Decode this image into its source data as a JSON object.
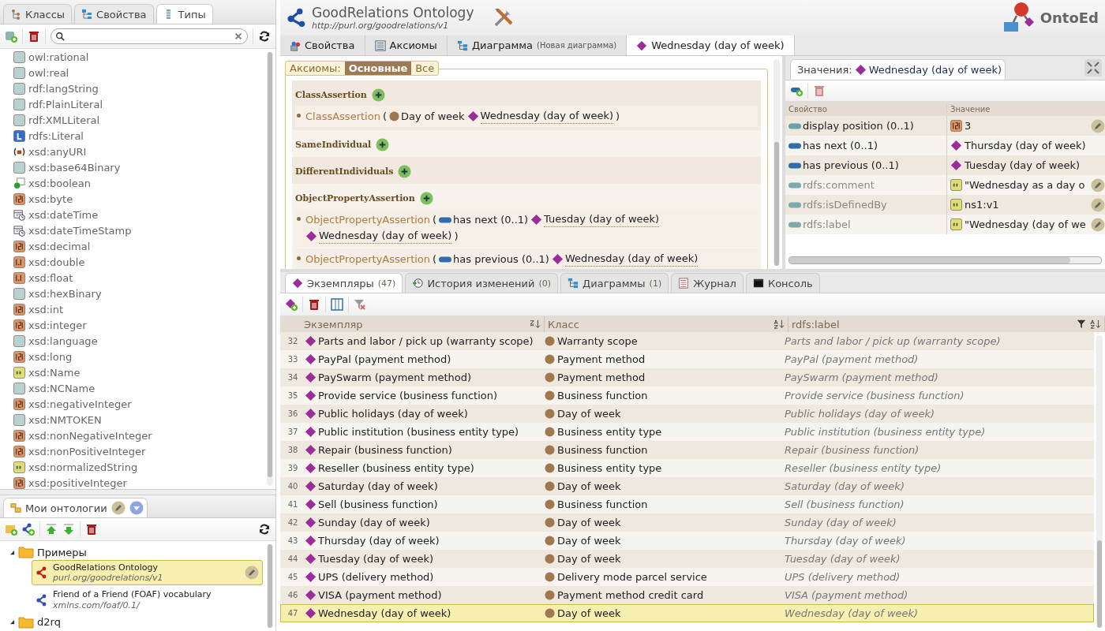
{
  "left_tabs": [
    {
      "label": "Классы",
      "kind": "classes",
      "selected": false
    },
    {
      "label": "Свойства",
      "kind": "properties",
      "selected": false
    },
    {
      "label": "Типы",
      "kind": "types",
      "selected": true
    }
  ],
  "types": [
    {
      "name": "owl:rational",
      "kind": "plain"
    },
    {
      "name": "owl:real",
      "kind": "plain"
    },
    {
      "name": "rdf:langString",
      "kind": "plain"
    },
    {
      "name": "rdf:PlainLiteral",
      "kind": "plain"
    },
    {
      "name": "rdf:XMLLiteral",
      "kind": "plain"
    },
    {
      "name": "rdfs:Literal",
      "kind": "literal"
    },
    {
      "name": "xsd:anyURI",
      "kind": "uri"
    },
    {
      "name": "xsd:base64Binary",
      "kind": "plain"
    },
    {
      "name": "xsd:boolean",
      "kind": "boolean"
    },
    {
      "name": "xsd:byte",
      "kind": "number"
    },
    {
      "name": "xsd:dateTime",
      "kind": "datetime"
    },
    {
      "name": "xsd:dateTimeStamp",
      "kind": "datetime"
    },
    {
      "name": "xsd:decimal",
      "kind": "number"
    },
    {
      "name": "xsd:double",
      "kind": "decimal"
    },
    {
      "name": "xsd:float",
      "kind": "decimal"
    },
    {
      "name": "xsd:hexBinary",
      "kind": "plain"
    },
    {
      "name": "xsd:int",
      "kind": "number"
    },
    {
      "name": "xsd:integer",
      "kind": "number"
    },
    {
      "name": "xsd:language",
      "kind": "plain"
    },
    {
      "name": "xsd:long",
      "kind": "number"
    },
    {
      "name": "xsd:Name",
      "kind": "string"
    },
    {
      "name": "xsd:NCName",
      "kind": "plain"
    },
    {
      "name": "xsd:negativeInteger",
      "kind": "number"
    },
    {
      "name": "xsd:NMTOKEN",
      "kind": "plain"
    },
    {
      "name": "xsd:nonNegativeInteger",
      "kind": "number"
    },
    {
      "name": "xsd:nonPositiveInteger",
      "kind": "number"
    },
    {
      "name": "xsd:normalizedString",
      "kind": "string"
    },
    {
      "name": "xsd:positiveInteger",
      "kind": "number"
    }
  ],
  "ontologies_panel": {
    "title": "Мои онтологии",
    "tree": [
      {
        "label": "Примеры",
        "expanded": true,
        "children": [
          {
            "label": "GoodRelations Ontology",
            "uri": "purl.org/goodrelations/v1",
            "selected": true
          },
          {
            "label": "Friend of a Friend (FOAF) vocabulary",
            "uri": "xmlns.com/foaf/0.1/",
            "selected": false
          }
        ]
      },
      {
        "label": "d2rq",
        "expanded": true
      }
    ]
  },
  "header": {
    "title": "GoodRelations Ontology",
    "uri": "http://purl.org/goodrelations/v1",
    "logo": "OntoEd"
  },
  "main_tabs": [
    {
      "label": "Свойства",
      "kind": "properties",
      "selected": false
    },
    {
      "label": "Аксиомы",
      "kind": "axioms",
      "selected": false
    },
    {
      "label": "Диаграмма",
      "note": "(Новая диаграмма)",
      "kind": "diagram",
      "selected": false
    },
    {
      "label": "Wednesday (day of week)",
      "kind": "individual",
      "selected": true
    }
  ],
  "axiom_filter": {
    "label": "Аксиомы:",
    "options": [
      {
        "label": "Основные",
        "selected": true
      },
      {
        "label": "Все",
        "selected": false
      }
    ]
  },
  "axiom_sections": [
    {
      "title": "ClassAssertion",
      "items": [
        [
          {
            "kind": "fn",
            "text": "ClassAssertion"
          },
          {
            "kind": "punct",
            "text": "("
          },
          {
            "kind": "class",
            "text": "Day of week"
          },
          {
            "kind": "individual",
            "text": "Wednesday (day of week)"
          },
          {
            "kind": "punct",
            "text": ")"
          }
        ]
      ]
    },
    {
      "title": "SameIndividual"
    },
    {
      "title": "DifferentIndividuals"
    },
    {
      "title": "ObjectPropertyAssertion",
      "items": [
        [
          {
            "kind": "fn",
            "text": "ObjectPropertyAssertion"
          },
          {
            "kind": "punct",
            "text": "("
          },
          {
            "kind": "property",
            "text": "has next (0..1)"
          },
          {
            "kind": "individual",
            "text": "Tuesday (day of week)"
          },
          {
            "kind": "individual",
            "text": "Wednesday (day of week)"
          },
          {
            "kind": "punct",
            "text": ")"
          }
        ],
        [
          {
            "kind": "fn",
            "text": "ObjectPropertyAssertion"
          },
          {
            "kind": "punct",
            "text": "("
          },
          {
            "kind": "property",
            "text": "has previous (0..1)"
          },
          {
            "kind": "individual",
            "text": "Wednesday (day of week)"
          }
        ]
      ]
    }
  ],
  "values_panel": {
    "title": "Значения:",
    "subject": "Wednesday (day of week)",
    "columns": [
      "Свойство",
      "Значение"
    ],
    "rows": [
      {
        "property": {
          "kind": "data",
          "text": "display position (0..1)"
        },
        "value": {
          "kind": "number",
          "text": "3"
        },
        "editable": true
      },
      {
        "property": {
          "kind": "object",
          "text": "has next (0..1)"
        },
        "value": {
          "kind": "individual",
          "text": "Thursday (day of week)"
        },
        "editable": false
      },
      {
        "property": {
          "kind": "object",
          "text": "has previous (0..1)"
        },
        "value": {
          "kind": "individual",
          "text": "Tuesday (day of week)"
        },
        "editable": false
      },
      {
        "property": {
          "kind": "annotation",
          "text": "rdfs:comment"
        },
        "value": {
          "kind": "string",
          "text": "\"Wednesday as a day o"
        },
        "editable": true
      },
      {
        "property": {
          "kind": "annotation",
          "text": "rdfs:isDefinedBy"
        },
        "value": {
          "kind": "string",
          "text": "ns1:v1"
        },
        "editable": true
      },
      {
        "property": {
          "kind": "annotation",
          "text": "rdfs:label"
        },
        "value": {
          "kind": "string",
          "text": "\"Wednesday (day of we"
        },
        "editable": true
      }
    ]
  },
  "bottom_tabs": [
    {
      "label": "Экземпляры",
      "count": "(47)",
      "kind": "individuals",
      "selected": true
    },
    {
      "label": "История изменений",
      "count": "(0)",
      "kind": "history",
      "selected": false
    },
    {
      "label": "Диаграммы",
      "count": "(1)",
      "kind": "diagram",
      "selected": false
    },
    {
      "label": "Журнал",
      "kind": "log",
      "selected": false
    },
    {
      "label": "Консоль",
      "kind": "console",
      "selected": false
    }
  ],
  "table": {
    "columns": [
      "Экземпляр",
      "Класс",
      "rdfs:label"
    ],
    "rows": [
      {
        "n": "32",
        "individual": "Parts and labor / pick up (warranty scope)",
        "class": "Warranty scope",
        "label": "Parts and labor / pick up (warranty scope)",
        "selected": false
      },
      {
        "n": "33",
        "individual": "PayPal (payment method)",
        "class": "Payment method",
        "label": "PayPal (payment method)",
        "selected": false
      },
      {
        "n": "34",
        "individual": "PaySwarm (payment method)",
        "class": "Payment method",
        "label": "PaySwarm (payment method)",
        "selected": false
      },
      {
        "n": "35",
        "individual": "Provide service (business function)",
        "class": "Business function",
        "label": "Provide service (business function)",
        "selected": false
      },
      {
        "n": "36",
        "individual": "Public holidays (day of week)",
        "class": "Day of week",
        "label": "Public holidays (day of week)",
        "selected": false
      },
      {
        "n": "37",
        "individual": "Public institution (business entity type)",
        "class": "Business entity type",
        "label": "Public institution (business entity type)",
        "selected": false
      },
      {
        "n": "38",
        "individual": "Repair (business function)",
        "class": "Business function",
        "label": "Repair (business function)",
        "selected": false
      },
      {
        "n": "39",
        "individual": "Reseller (business entity type)",
        "class": "Business entity type",
        "label": "Reseller (business entity type)",
        "selected": false
      },
      {
        "n": "40",
        "individual": "Saturday (day of week)",
        "class": "Day of week",
        "label": "Saturday (day of week)",
        "selected": false
      },
      {
        "n": "41",
        "individual": "Sell (business function)",
        "class": "Business function",
        "label": "Sell (business function)",
        "selected": false
      },
      {
        "n": "42",
        "individual": "Sunday (day of week)",
        "class": "Day of week",
        "label": "Sunday (day of week)",
        "selected": false
      },
      {
        "n": "43",
        "individual": "Thursday (day of week)",
        "class": "Day of week",
        "label": "Thursday (day of week)",
        "selected": false
      },
      {
        "n": "44",
        "individual": "Tuesday (day of week)",
        "class": "Day of week",
        "label": "Tuesday (day of week)",
        "selected": false
      },
      {
        "n": "45",
        "individual": "UPS (delivery method)",
        "class": "Delivery mode parcel service",
        "label": "UPS (delivery method)",
        "selected": false
      },
      {
        "n": "46",
        "individual": "VISA (payment method)",
        "class": "Payment method credit card",
        "label": "VISA (payment method)",
        "selected": false
      },
      {
        "n": "47",
        "individual": "Wednesday (day of week)",
        "class": "Day of week",
        "label": "Wednesday (day of week)",
        "selected": true
      }
    ]
  }
}
